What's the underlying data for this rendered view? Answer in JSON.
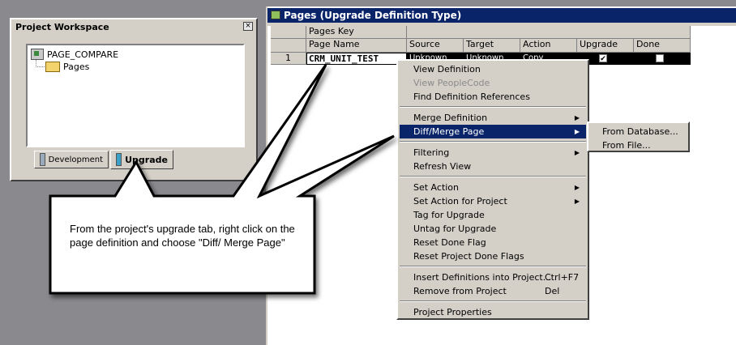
{
  "workspace": {
    "title": "Project Workspace",
    "close_glyph": "×",
    "tree": {
      "project": "PAGE_COMPARE",
      "folder": "Pages"
    },
    "tabs": [
      {
        "label": "Development",
        "icon": "development-icon"
      },
      {
        "label": "Upgrade",
        "icon": "upgrade-icon",
        "active": true
      }
    ]
  },
  "pages_window": {
    "title": "Pages (Upgrade Definition Type)",
    "key_header": "Pages Key",
    "columns": [
      "Page Name",
      "Source",
      "Target",
      "Action",
      "Upgrade",
      "Done"
    ],
    "row": {
      "number": "1",
      "page_name": "CRM_UNIT_TEST",
      "source": "Unknown",
      "target": "Unknown",
      "action": "Copy",
      "upgrade_checked": true,
      "done_checked": false
    }
  },
  "context_menu": {
    "groups": [
      [
        {
          "label": "View Definition"
        },
        {
          "label": "View PeopleCode",
          "disabled": true
        },
        {
          "label": "Find Definition References"
        }
      ],
      [
        {
          "label": "Merge Definition",
          "submenu": true
        },
        {
          "label": "Diff/Merge Page",
          "submenu": true,
          "highlighted": true
        }
      ],
      [
        {
          "label": "Filtering",
          "submenu": true
        },
        {
          "label": "Refresh View"
        }
      ],
      [
        {
          "label": "Set Action",
          "submenu": true
        },
        {
          "label": "Set Action for Project",
          "submenu": true
        },
        {
          "label": "Tag for Upgrade"
        },
        {
          "label": "Untag for Upgrade"
        },
        {
          "label": "Reset Done Flag"
        },
        {
          "label": "Reset Project Done Flags"
        }
      ],
      [
        {
          "label": "Insert Definitions into Project...",
          "shortcut": "Ctrl+F7"
        },
        {
          "label": "Remove from Project",
          "shortcut": "Del"
        }
      ],
      [
        {
          "label": "Project Properties"
        }
      ]
    ],
    "submenu_items": [
      "From Database...",
      "From File..."
    ]
  },
  "callout": {
    "text": "From the project's upgrade tab, right click on the page definition and choose \"Diff/ Merge Page\""
  },
  "colors": {
    "title_bar": "#0a246a",
    "menu_face": "#d4d0c8",
    "background": "#8a8a8e"
  }
}
